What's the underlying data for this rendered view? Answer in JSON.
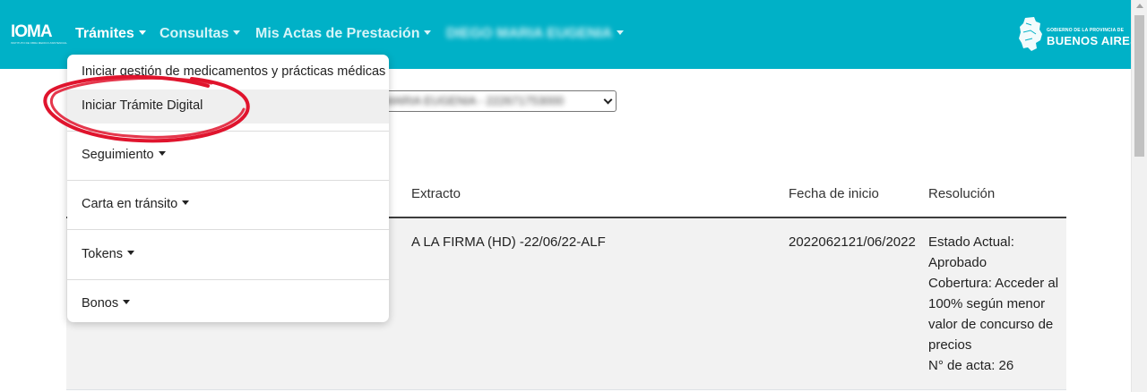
{
  "brand": {
    "name": "IOMA",
    "subtitle": "INSTITUTO DE OBRA MEDICO ASISTENCIAL"
  },
  "nav": {
    "items": [
      {
        "label": "Trámites"
      },
      {
        "label": "Consultas"
      },
      {
        "label": "Mis Actas de Prestación"
      },
      {
        "label": "DIEGO MARIA EUGENIA"
      }
    ]
  },
  "government": {
    "line1": "GOBIERNO DE LA PROVINCIA DE",
    "line2": "BUENOS AIRES"
  },
  "dropdown": {
    "items": [
      {
        "label": "Iniciar gestión de medicamentos y prácticas médicas"
      },
      {
        "label": "Iniciar Trámite Digital"
      },
      {
        "label": "Seguimiento"
      },
      {
        "label": "Carta en tránsito"
      },
      {
        "label": "Tokens"
      },
      {
        "label": "Bonos"
      }
    ]
  },
  "affiliate_select": {
    "value": "MARIA EUGENIA - 222671753000"
  },
  "table": {
    "headers": [
      "Extracto",
      "Fecha de inicio",
      "Resolución"
    ],
    "rows": [
      {
        "extracto": "A LA FIRMA (HD) -22/06/22-ALF",
        "fecha": "2022062121/06/2022",
        "resolucion": [
          "Estado Actual:",
          "Aprobado",
          "Cobertura: Acceder al",
          "100% según menor",
          "valor de concurso de",
          "precios",
          "N° de acta: 26"
        ]
      }
    ]
  },
  "colors": {
    "navbar": "#00b1c7",
    "highlight_circle": "#e0142d"
  }
}
